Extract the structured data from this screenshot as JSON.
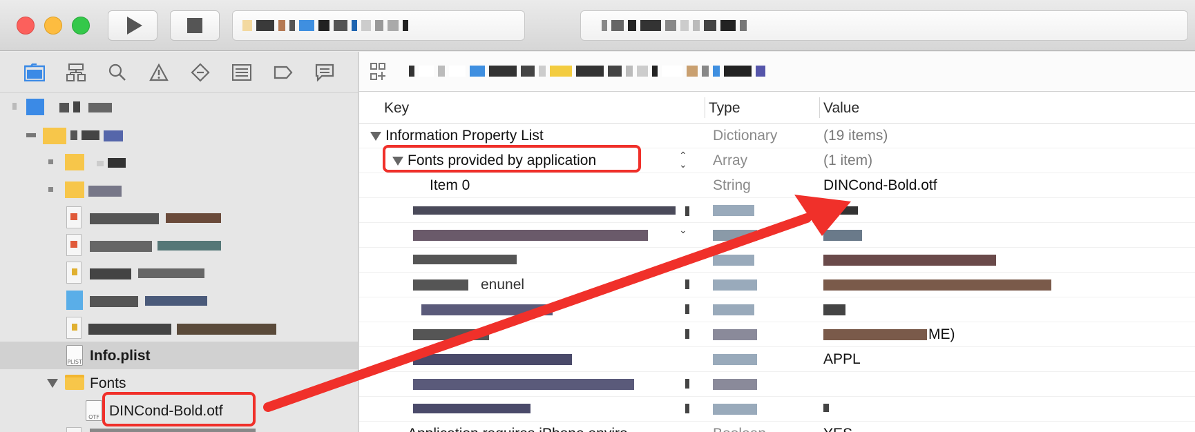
{
  "toolbar": {
    "run_icon": "play-icon",
    "stop_icon": "stop-icon"
  },
  "navigator": {
    "tab_icons": [
      "folder-icon",
      "hierarchy-icon",
      "search-icon",
      "warning-icon",
      "test-icon",
      "debug-icon",
      "breakpoint-icon",
      "report-icon"
    ],
    "items": {
      "info_plist": "Info.plist",
      "fonts_folder": "Fonts",
      "font_file": "DINCond-Bold.otf"
    },
    "file_icon_caption": "PLIST",
    "font_icon_caption": "OTF"
  },
  "editor": {
    "columns": {
      "key": "Key",
      "type": "Type",
      "value": "Value"
    },
    "rows": [
      {
        "key": "Information Property List",
        "type": "Dictionary",
        "value": "(19 items)"
      },
      {
        "key": "Fonts provided by application",
        "type": "Array",
        "value": "(1 item)"
      },
      {
        "key": "Item 0",
        "type": "String",
        "value": "DINCond-Bold.otf"
      }
    ],
    "partial_values": {
      "row9_value_tail": "ME)",
      "row10_value": "APPL",
      "row_last_key": "Application requires iPhone enviro",
      "row_last_type": "Boolean",
      "row_last_value": "YES",
      "row6_key_fragment": "enunel"
    }
  },
  "annotation": {
    "highlight_color": "#f0302a"
  }
}
